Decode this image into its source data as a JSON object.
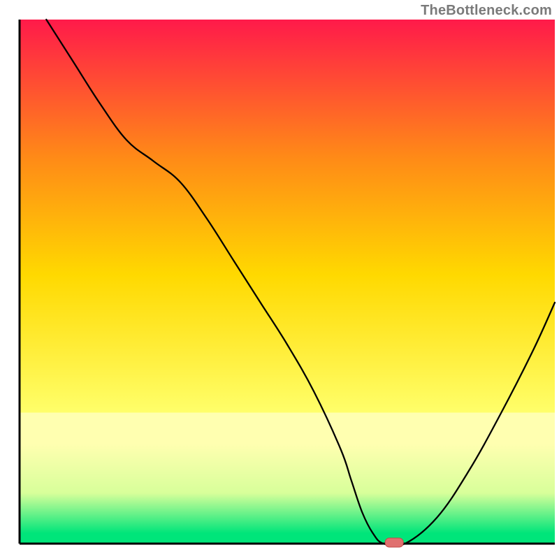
{
  "watermark": "TheBottleneck.com",
  "colors": {
    "gradient_top": "#ff1a4a",
    "gradient_mid1": "#ff8a17",
    "gradient_mid2": "#ffd900",
    "gradient_mid3": "#ffff6a",
    "gradient_band_yellow": "#ffffb0",
    "gradient_green": "#00e57a",
    "axis": "#000000",
    "curve": "#000000",
    "marker_fill": "#e0706f",
    "marker_stroke": "#c24a4a"
  },
  "chart_data": {
    "type": "line",
    "title": "",
    "xlabel": "",
    "ylabel": "",
    "x_range": [
      0,
      100
    ],
    "y_range": [
      0,
      100
    ],
    "grid": false,
    "series": [
      {
        "name": "bottleneck-curve",
        "x": [
          5,
          10,
          15,
          20,
          25,
          30,
          35,
          40,
          45,
          50,
          55,
          60,
          62,
          64,
          66,
          68,
          72,
          78,
          84,
          90,
          96,
          100
        ],
        "values": [
          100,
          92,
          84,
          77,
          73,
          69,
          62,
          54,
          46,
          38,
          29,
          18,
          12,
          6,
          2,
          0,
          0,
          5,
          14,
          25,
          37,
          46
        ]
      }
    ],
    "marker": {
      "x": 70,
      "y": 0
    },
    "bands": [
      {
        "name": "main-gradient",
        "from_y": 25,
        "to_y": 100
      },
      {
        "name": "pale-yellow",
        "from_y": 19,
        "to_y": 25
      },
      {
        "name": "yellow-green-fade",
        "from_y": 2,
        "to_y": 19
      },
      {
        "name": "green-strip",
        "from_y": 0,
        "to_y": 2
      }
    ]
  }
}
